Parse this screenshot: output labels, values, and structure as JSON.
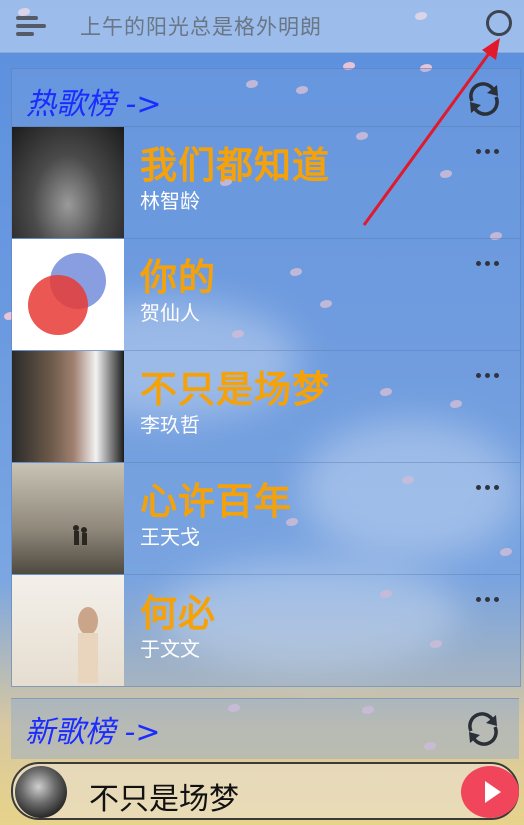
{
  "topbar": {
    "title": "上午的阳光总是格外明朗",
    "menu_icon": "menu-icon",
    "search_icon": "search-icon"
  },
  "hot_list": {
    "title": "热歌榜 ->",
    "refresh_icon": "refresh-icon",
    "songs": [
      {
        "name": "我们都知道",
        "artist": "林智龄"
      },
      {
        "name": "你的",
        "artist": "贺仙人"
      },
      {
        "name": "不只是场梦",
        "artist": "李玖哲"
      },
      {
        "name": "心许百年",
        "artist": "王天戈"
      },
      {
        "name": "何必",
        "artist": "于文文"
      }
    ]
  },
  "new_list": {
    "title": "新歌榜 ->",
    "refresh_icon": "refresh-icon"
  },
  "player": {
    "title": "不只是场梦",
    "play_icon": "play-icon"
  },
  "colors": {
    "song_name": "#f5a20a",
    "section_title": "#1a2cff",
    "play_button": "#f0455a",
    "annotation_arrow": "#e0192b"
  }
}
